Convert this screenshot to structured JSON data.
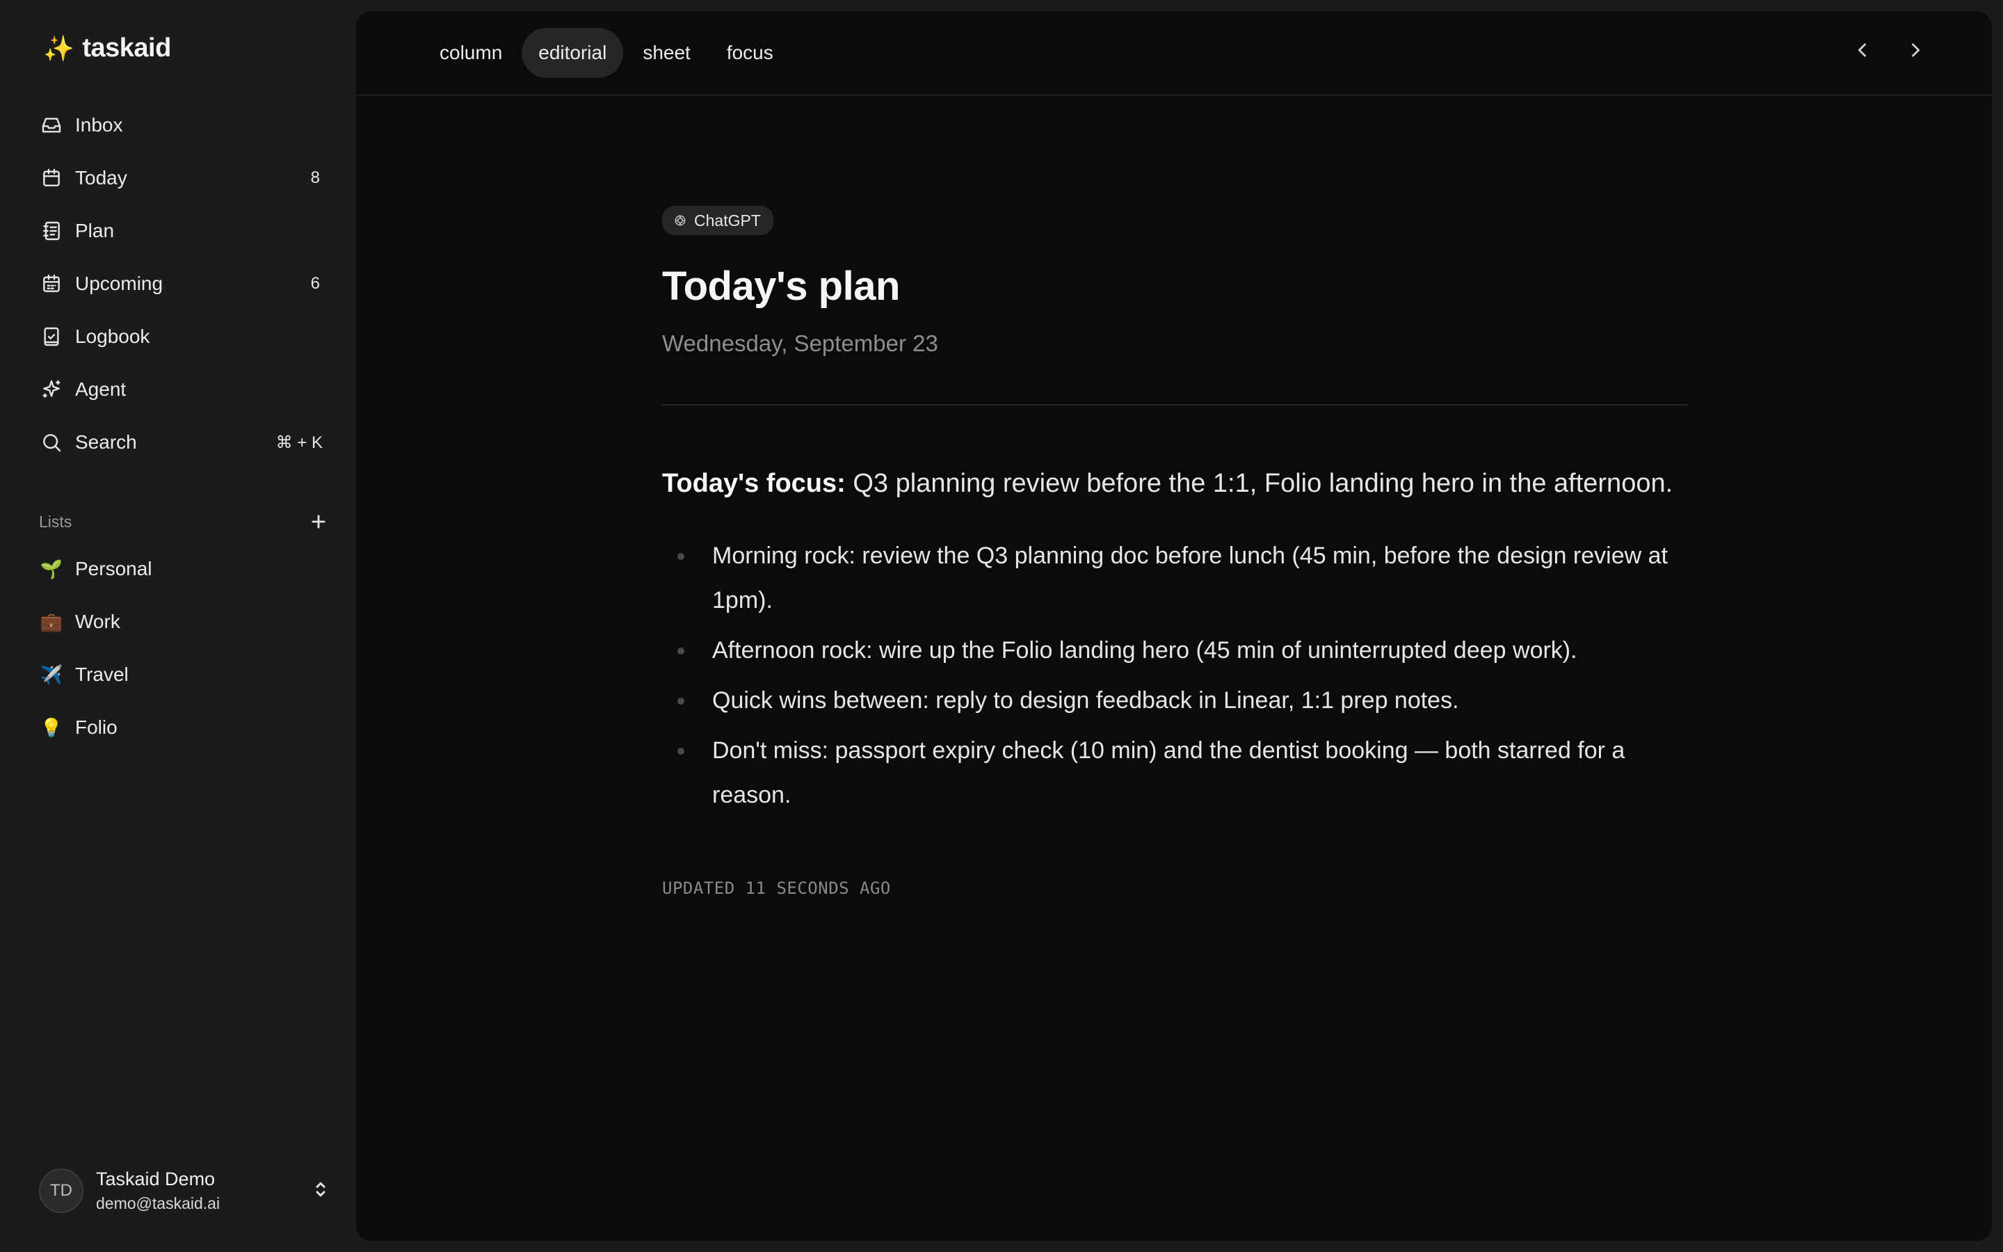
{
  "brand": {
    "name": "taskaid",
    "icon": "sparkles-icon"
  },
  "nav": {
    "items": [
      {
        "label": "Inbox",
        "icon": "inbox-icon",
        "count": ""
      },
      {
        "label": "Today",
        "icon": "calendar-icon",
        "count": "8"
      },
      {
        "label": "Plan",
        "icon": "notebook-icon",
        "count": ""
      },
      {
        "label": "Upcoming",
        "icon": "calendar-grid-icon",
        "count": "6"
      },
      {
        "label": "Logbook",
        "icon": "logbook-icon",
        "count": ""
      },
      {
        "label": "Agent",
        "icon": "sparkle-agent-icon",
        "count": ""
      },
      {
        "label": "Search",
        "icon": "search-icon",
        "shortcut": "⌘ + K"
      }
    ]
  },
  "lists": {
    "heading": "Lists",
    "items": [
      {
        "emoji": "🌱",
        "label": "Personal"
      },
      {
        "emoji": "💼",
        "label": "Work"
      },
      {
        "emoji": "✈️",
        "label": "Travel"
      },
      {
        "emoji": "💡",
        "label": "Folio"
      }
    ]
  },
  "user": {
    "initials": "TD",
    "name": "Taskaid Demo",
    "email": "demo@taskaid.ai"
  },
  "toolbar": {
    "tabs": [
      {
        "label": "column",
        "active": false
      },
      {
        "label": "editorial",
        "active": true
      },
      {
        "label": "sheet",
        "active": false
      },
      {
        "label": "focus",
        "active": false
      }
    ]
  },
  "doc": {
    "badge": "ChatGPT",
    "title": "Today's plan",
    "date": "Wednesday, September 23",
    "focus_label": "Today's focus:",
    "focus_text": " Q3 planning review before the 1:1, Folio landing hero in the afternoon.",
    "bullets": [
      "Morning rock: review the Q3 planning doc before lunch (45 min, before the design review at 1pm).",
      "Afternoon rock: wire up the Folio landing hero (45 min of uninterrupted deep work).",
      "Quick wins between: reply to design feedback in Linear, 1:1 prep notes.",
      "Don't miss: passport expiry check (10 min) and the dentist booking — both starred for a reason."
    ],
    "updated": "UPDATED 11 SECONDS AGO"
  }
}
